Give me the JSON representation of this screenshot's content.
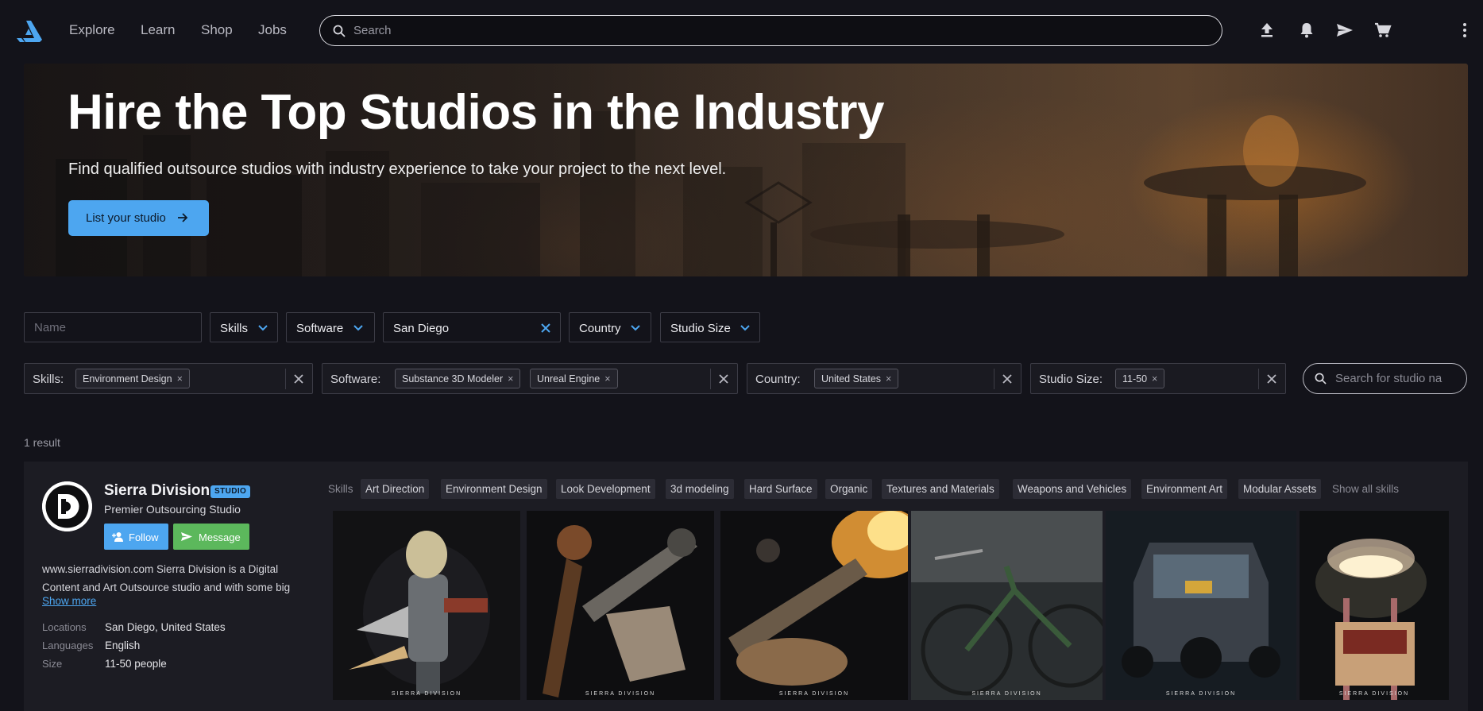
{
  "nav": {
    "links": [
      "Explore",
      "Learn",
      "Shop",
      "Jobs"
    ],
    "search_placeholder": "Search",
    "icons": [
      "upload-icon",
      "bell-icon",
      "send-icon",
      "cart-icon",
      "more-vertical-icon"
    ]
  },
  "hero": {
    "title": "Hire the Top Studios in the Industry",
    "subtitle": "Find qualified outsource studios with industry experience to take your project to the next level.",
    "button_label": "List your studio"
  },
  "filters": {
    "name_placeholder": "Name",
    "skills_label": "Skills",
    "software_label": "Software",
    "location_value": "San Diego",
    "country_label": "Country",
    "studio_size_label": "Studio Size"
  },
  "active_filters": {
    "skills": {
      "label": "Skills:",
      "chips": [
        "Environment Design"
      ]
    },
    "software": {
      "label": "Software:",
      "chips": [
        "Substance 3D Modeler",
        "Unreal Engine"
      ]
    },
    "country": {
      "label": "Country:",
      "chips": [
        "United States"
      ]
    },
    "size": {
      "label": "Studio Size:",
      "chips": [
        "11-50"
      ]
    },
    "studio_search_placeholder": "Search for studio na"
  },
  "results": {
    "count_text": "1 result"
  },
  "studio": {
    "name": "Sierra Division",
    "badge": "STUDIO",
    "tagline": "Premier Outsourcing Studio",
    "follow_label": "Follow",
    "message_label": "Message",
    "description": "www.sierradivision.com Sierra Division is a Digital Content and Art Outsource studio and with some big",
    "show_more": "Show more",
    "meta": {
      "locations_label": "Locations",
      "locations_value": "San Diego, United States",
      "languages_label": "Languages",
      "languages_value": "English",
      "size_label": "Size",
      "size_value": "11-50 people"
    },
    "skills_label": "Skills",
    "skills": [
      "Art Direction",
      "Environment Design",
      "Look Development",
      "3d modeling",
      "Hard Surface",
      "Organic",
      "Textures and Materials",
      "Weapons and Vehicles",
      "Environment Art",
      "Modular Assets"
    ],
    "show_all_skills": "Show all skills",
    "watermark": "SIERRA DIVISION"
  },
  "colors": {
    "background": "#13131a",
    "accent": "#4da6f0",
    "message_green": "#5cb85c",
    "card": "#1c1c23"
  }
}
